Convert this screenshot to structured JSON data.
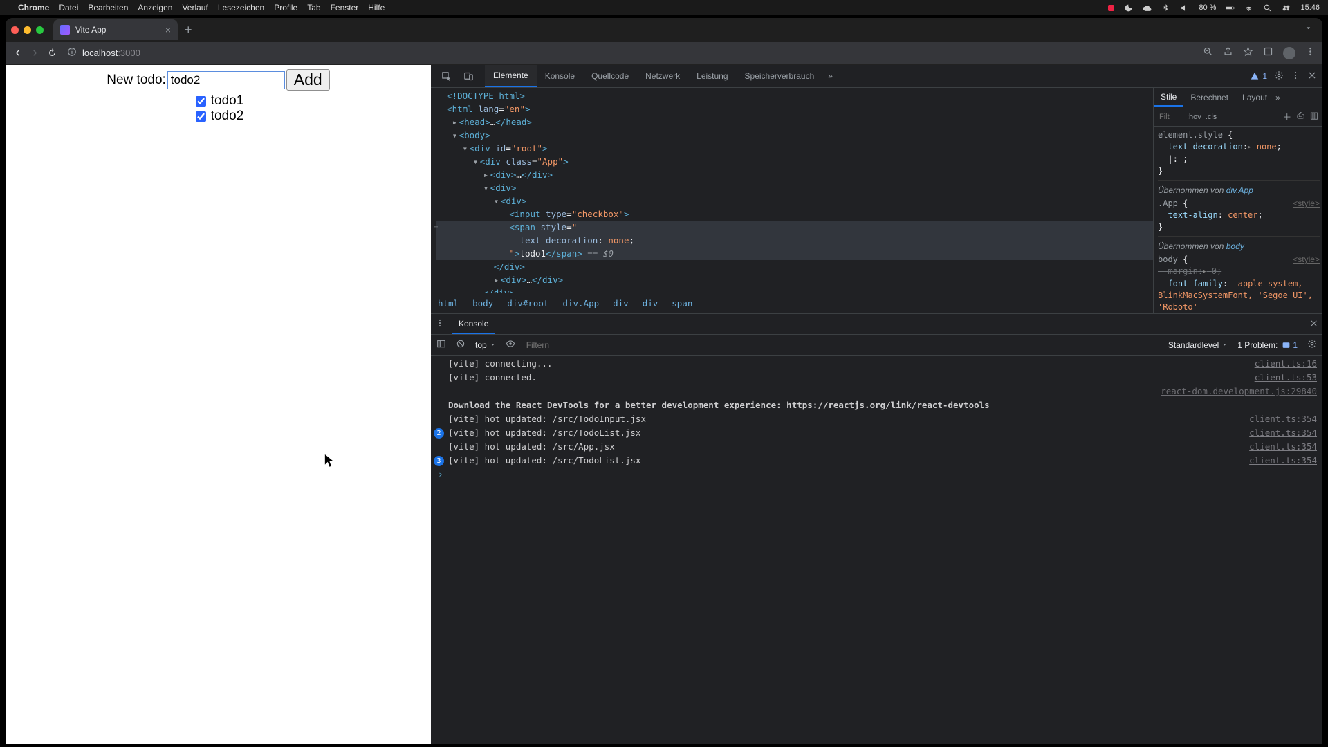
{
  "menubar": {
    "app": "Chrome",
    "items": [
      "Datei",
      "Bearbeiten",
      "Anzeigen",
      "Verlauf",
      "Lesezeichen",
      "Profile",
      "Tab",
      "Fenster",
      "Hilfe"
    ],
    "battery": "80 %",
    "clock": "15:46"
  },
  "browser": {
    "tab_title": "Vite App",
    "url_host": "localhost",
    "url_port": ":3000"
  },
  "app": {
    "input_label": "New todo:",
    "input_value": "todo2",
    "add_button": "Add",
    "todos": [
      {
        "label": "todo1",
        "checked": true,
        "struck": false
      },
      {
        "label": "todo2",
        "checked": true,
        "struck": true
      }
    ]
  },
  "devtools": {
    "tabs": [
      "Elemente",
      "Konsole",
      "Quellcode",
      "Netzwerk",
      "Leistung",
      "Speicherverbrauch"
    ],
    "issue_count": "1",
    "breadcrumb": [
      "html",
      "body",
      "div#root",
      "div.App",
      "div",
      "div",
      "span"
    ],
    "styles": {
      "tabs": [
        "Stile",
        "Berechnet",
        "Layout"
      ],
      "filter_placeholder": "Filt",
      "hov": ":hov",
      "cls": ".cls",
      "element_style_label": "element.style",
      "element_style": [
        {
          "prop": "text-decoration",
          "val": "none"
        }
      ],
      "inherit1_label": "Übernommen von",
      "inherit1_sel": "div.App",
      "app_rule_sel": ".App",
      "app_rules": [
        {
          "prop": "text-align",
          "val": "center"
        }
      ],
      "inherit2_sel": "body",
      "body_rules": [
        {
          "prop": "margin",
          "val": "0",
          "struck": true
        },
        {
          "prop": "font-family",
          "val": "-apple-system, BlinkMacSystemFont, 'Segoe UI', 'Roboto'"
        }
      ],
      "style_origin": "<style>"
    },
    "console": {
      "drawer_tab": "Konsole",
      "ctx": "top",
      "filter_placeholder": "Filtern",
      "level": "Standardlevel",
      "problems_label": "1 Problem:",
      "problems_count": "1",
      "logs": [
        {
          "badge": "",
          "msg": "[vite] connecting...",
          "src": "client.ts:16"
        },
        {
          "badge": "",
          "msg": "[vite] connected.",
          "src": "client.ts:53"
        },
        {
          "badge": "",
          "msg": "",
          "src": "react-dom.development.js:29840",
          "dim": true
        },
        {
          "badge": "",
          "msg": "Download the React DevTools for a better development experience: ",
          "link": "https://reactjs.org/link/react-devtools",
          "react": true
        },
        {
          "badge": "",
          "msg": "[vite] hot updated: /src/TodoInput.jsx",
          "src": "client.ts:354"
        },
        {
          "badge": "2",
          "msg": "[vite] hot updated: /src/TodoList.jsx",
          "src": "client.ts:354"
        },
        {
          "badge": "",
          "msg": "[vite] hot updated: /src/App.jsx",
          "src": "client.ts:354"
        },
        {
          "badge": "3",
          "msg": "[vite] hot updated: /src/TodoList.jsx",
          "src": "client.ts:354"
        }
      ]
    },
    "dom_span_text": "todo1"
  }
}
